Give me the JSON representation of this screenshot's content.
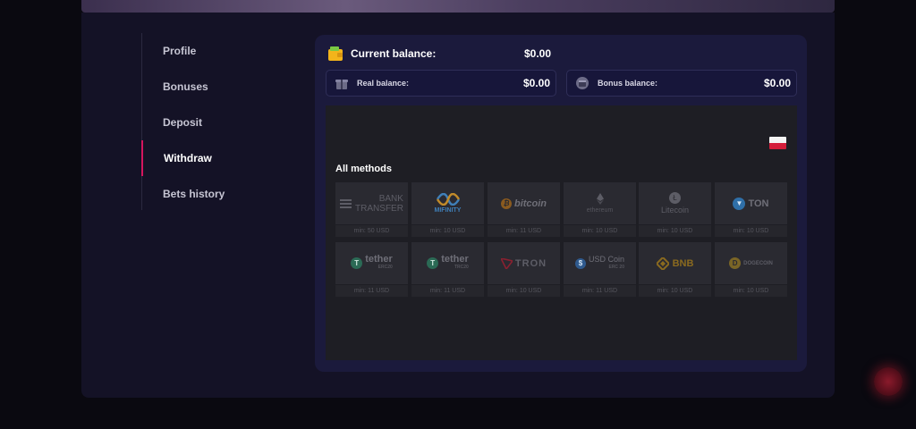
{
  "sidebar": {
    "items": [
      {
        "label": "Profile"
      },
      {
        "label": "Bonuses"
      },
      {
        "label": "Deposit"
      },
      {
        "label": "Withdraw",
        "active": true
      },
      {
        "label": "Bets history"
      }
    ]
  },
  "balance": {
    "current_label": "Current balance:",
    "current_value": "$0.00",
    "real_label": "Real balance:",
    "real_value": "$0.00",
    "bonus_label": "Bonus balance:",
    "bonus_value": "$0.00"
  },
  "methods": {
    "title": "All methods",
    "tiles": [
      {
        "name": "BANK TRANSFER",
        "line1": "BANK",
        "line2": "TRANSFER",
        "min": "min: 50 USD",
        "icon": "bank-icon"
      },
      {
        "name": "MIFINITY",
        "line1": "MIFINITY",
        "min": "min: 10 USD",
        "icon": "mifinity-icon"
      },
      {
        "name": "bitcoin",
        "line1": "bitcoin",
        "min": "min: 11 USD",
        "icon": "bitcoin-icon"
      },
      {
        "name": "ethereum",
        "line1": "ethereum",
        "min": "min: 10 USD",
        "icon": "ethereum-icon"
      },
      {
        "name": "Litecoin",
        "line1": "Litecoin",
        "min": "min: 10 USD",
        "icon": "litecoin-icon"
      },
      {
        "name": "TON",
        "line1": "TON",
        "min": "min: 10 USD",
        "icon": "ton-icon"
      },
      {
        "name": "tether ERC20",
        "line1": "tether",
        "line2": "ERC20",
        "min": "min: 11 USD",
        "icon": "tether-icon"
      },
      {
        "name": "tether TRC20",
        "line1": "tether",
        "line2": "TRC20",
        "min": "min: 11 USD",
        "icon": "tether-icon"
      },
      {
        "name": "TRON",
        "line1": "TRON",
        "min": "min: 10 USD",
        "icon": "tron-icon"
      },
      {
        "name": "USD Coin ERC 20",
        "line1": "USD Coin",
        "line2": "ERC 20",
        "min": "min: 11 USD",
        "icon": "usdcoin-icon"
      },
      {
        "name": "BNB",
        "line1": "BNB",
        "min": "min: 10 USD",
        "icon": "bnb-icon"
      },
      {
        "name": "DOGECOIN",
        "line1": "DOGECOIN",
        "min": "min: 10 USD",
        "icon": "dogecoin-icon"
      }
    ]
  },
  "colors": {
    "accent": "#d5165e",
    "panel": "#141226",
    "card": "#1b1a3c",
    "methods_bg": "#1e1e24"
  }
}
